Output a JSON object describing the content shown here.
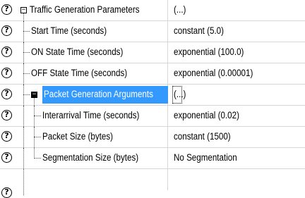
{
  "grid": {
    "rows": [
      {
        "name": "Traffic Generation Parameters",
        "value": "(...)"
      },
      {
        "name": "Start Time (seconds)",
        "value": "constant (5.0)"
      },
      {
        "name": "ON State Time (seconds)",
        "value": "exponential (100.0)"
      },
      {
        "name": "OFF State Time (seconds)",
        "value": "exponential (0.00001)"
      },
      {
        "name": "Packet Generation Arguments",
        "value": "(...)"
      },
      {
        "name": "Interarrival Time (seconds)",
        "value": "exponential (0.02)"
      },
      {
        "name": "Packet Size (bytes)",
        "value": "constant (1500)"
      },
      {
        "name": "Segmentation Size (bytes)",
        "value": "No Segmentation"
      }
    ],
    "help_glyph": "?",
    "expanded_glyph": "−",
    "selection_color": "#3399ff"
  }
}
